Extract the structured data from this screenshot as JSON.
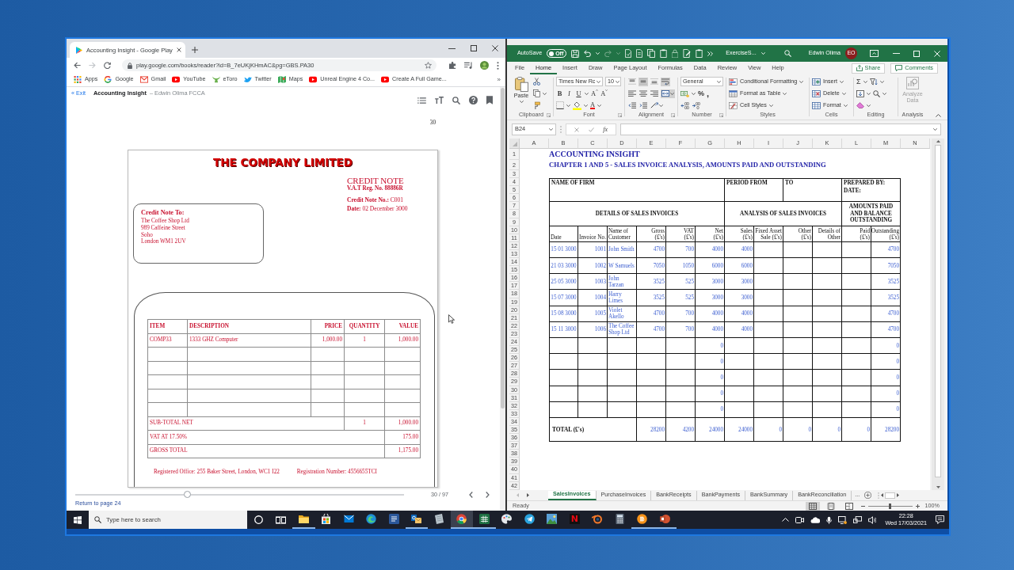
{
  "browser": {
    "tabs": [
      {
        "title": "Accounting Insight - Google Play",
        "selected": true
      }
    ],
    "forward": {
      "disabled": true
    },
    "address": "play.google.com/books/reader?id=B_7eUKjKHmAC&pg=GBS.PA30",
    "bookmarks": [
      {
        "label": "Apps",
        "kind": "apps"
      },
      {
        "label": "Google",
        "kind": "ring"
      },
      {
        "label": "Gmail",
        "kind": "envelope"
      },
      {
        "label": "YouTube",
        "kind": "play"
      },
      {
        "label": "eToro",
        "kind": "bull"
      },
      {
        "label": "Twitter",
        "kind": "bird"
      },
      {
        "label": "Maps",
        "kind": "map"
      },
      {
        "label": "Unreal Engine 4 Co...",
        "kind": "play"
      },
      {
        "label": "Create A Full Game...",
        "kind": "play"
      }
    ],
    "more_bookmarks": "»",
    "reader": {
      "exit": "« Exit",
      "book_title": "Accounting Insight",
      "author": "– Edwin Olima FCCA",
      "page_number": "30"
    },
    "document": {
      "company": "THE COMPANY LIMITED",
      "title": "CREDIT NOTE",
      "vat_reg": "V.A.T Reg. No. 88886R",
      "details": [
        "**Credit Note No.:** C001",
        "**Date:** 02 December 3000"
      ],
      "recipient": {
        "heading": "Credit Note To:",
        "lines": [
          "The Coffee Shop Ltd",
          "989 Caffeine Street",
          "Soho",
          "London WM1 2UV"
        ]
      },
      "columns": [
        "ITEM",
        "DESCRIPTION",
        "PRICE",
        "QUANTITY",
        "VALUE"
      ],
      "lines": [
        {
          "item": "COMP33",
          "description": "1333 GHZ Computer",
          "price": "1,000.00",
          "quantity": "1",
          "value": "1,000.00"
        }
      ],
      "totals": [
        {
          "label": "SUB-TOTAL NET",
          "quantity": "1",
          "value": "1,000.00"
        },
        {
          "label": "VAT AT 17.50%",
          "value": "175.00"
        },
        {
          "label": "GROSS TOTAL",
          "value": "1,175.00"
        }
      ],
      "footer": [
        "Registered Office: 255 Baker Street, London, WC1 I22",
        "Registration Number: 4556655TCI"
      ]
    },
    "footer": {
      "level": 0.34,
      "page_indicator": "30 / 97",
      "return_link": "Return to page 24"
    }
  },
  "excel": {
    "autosave": {
      "label": "AutoSave",
      "on": false,
      "text": "Off"
    },
    "redo": {
      "disabled": true
    },
    "file_name": "ExerciseS...",
    "user": {
      "name": "Edwin Olima",
      "initials": "EO"
    },
    "ribbon_tabs": [
      {
        "label": "File",
        "selected": false
      },
      {
        "label": "Home",
        "selected": true
      },
      {
        "label": "Insert",
        "selected": false
      },
      {
        "label": "Draw",
        "selected": false
      },
      {
        "label": "Page Layout",
        "selected": false
      },
      {
        "label": "Formulas",
        "selected": false
      },
      {
        "label": "Data",
        "selected": false
      },
      {
        "label": "Review",
        "selected": false
      },
      {
        "label": "View",
        "selected": false
      },
      {
        "label": "Help",
        "selected": false
      }
    ],
    "share": "Share",
    "comments": "Comments",
    "clipboard": {
      "paste": "Paste",
      "label": "Clipboard"
    },
    "font": {
      "face": "Times New Rc",
      "size": "10",
      "styles": [
        {
          "label": "B",
          "kind": "bold"
        },
        {
          "label": "I",
          "kind": "italic"
        },
        {
          "label": "U",
          "kind": "underline"
        }
      ],
      "grow": "A",
      "shrink": "A",
      "color_button": "A",
      "label": "Font"
    },
    "alignment": {
      "label": "Alignment",
      "buttons": [
        {
          "kind": "top",
          "selected": false
        },
        {
          "kind": "middle",
          "selected": true
        },
        {
          "kind": "bottom",
          "selected": false
        },
        {
          "kind": "wrap",
          "selected": true
        },
        {
          "kind": "left",
          "selected": false
        },
        {
          "kind": "center",
          "selected": false
        },
        {
          "kind": "right",
          "selected": false
        },
        {
          "kind": "merge",
          "selected": true
        },
        {
          "kind": "outdent",
          "selected": false
        },
        {
          "kind": "indent",
          "selected": false
        },
        {
          "kind": "orientation",
          "selected": false
        }
      ]
    },
    "number": {
      "format": "General",
      "percent": "%",
      "comma": ",",
      "label": "Number"
    },
    "styles": {
      "items": [
        {
          "label": "Conditional Formatting",
          "kind": "conditional"
        },
        {
          "label": "Format as Table",
          "kind": "table"
        },
        {
          "label": "Cell Styles",
          "kind": "cellstyle"
        }
      ],
      "label": "Styles"
    },
    "cells": {
      "items": [
        {
          "label": "Insert",
          "kind": "insert"
        },
        {
          "label": "Delete",
          "kind": "delete"
        },
        {
          "label": "Format",
          "kind": "format"
        }
      ],
      "label": "Cells"
    },
    "editing": {
      "sum": "Σ",
      "label": "Editing"
    },
    "analysis": {
      "button": "Analyze Data",
      "disabled": true,
      "label": "Analysis"
    },
    "formula_bar": {
      "name_box": "B24",
      "function_label": "fx"
    },
    "sheet": {
      "columns": [
        "A",
        "B",
        "C",
        "D",
        "E",
        "F",
        "G",
        "H",
        "I",
        "J",
        "K",
        "L",
        "M",
        "N"
      ],
      "rows": [
        "1",
        "2",
        "3",
        "4",
        "5",
        "6",
        "7",
        "8",
        "9",
        "10",
        "11",
        "12",
        "13",
        "14",
        "15",
        "16",
        "17",
        "18",
        "19",
        "20",
        "21",
        "22",
        "23",
        "24",
        "25",
        "26",
        "27",
        "28",
        "29",
        "30",
        "31",
        "32",
        "33",
        "34",
        "35",
        "36",
        "37",
        "38",
        "39",
        "40",
        "41",
        "42"
      ],
      "title": "ACCOUNTING INSIGHT",
      "subtitle": "CHAPTER 1 AND 5 - SALES INVOICE ANALYSIS, AMOUNTS PAID AND OUTSTANDING",
      "firm_label": "NAME OF FIRM",
      "period_from": "PERIOD FROM",
      "period_to": "TO",
      "prepared_by": "PREPARED BY:",
      "date_label": "DATE:",
      "sections": [
        "DETAILS OF SALES INVOICES",
        "ANALYSIS OF SALES INVOICES",
        "AMOUNTS PAID AND BALANCE OUTSTANDING"
      ],
      "headings": [
        [
          "Date"
        ],
        [
          "Invoice No."
        ],
        [
          "Name of",
          "Customer"
        ],
        [
          "Gross",
          "(£'s)"
        ],
        [
          "VAT",
          "(£'s)"
        ],
        [
          "Net",
          "(£'s)"
        ],
        [
          "Sales",
          "(£'s)"
        ],
        [
          "Fixed Asset",
          "Sale (£'s)"
        ],
        [
          "Other",
          "(£'s)"
        ],
        [
          "Details of",
          "Other"
        ],
        [
          "Paid",
          "(£'s)"
        ],
        [
          "Outstanding",
          "(£'s)"
        ]
      ],
      "entries": [
        {
          "date": "15 01 3000",
          "invoice": "1001",
          "customer": "John Smith",
          "gross": "4700",
          "vat": "700",
          "net": "4000",
          "sales": "4000",
          "outstanding": "4700"
        },
        {
          "date": "21 03 3000",
          "invoice": "1002",
          "customer": "W Samuels",
          "gross": "7050",
          "vat": "1050",
          "net": "6000",
          "sales": "6000",
          "outstanding": "7050"
        },
        {
          "date": "25 05 3000",
          "invoice": "1003",
          "customer": "John Tarzan",
          "gross": "3525",
          "vat": "525",
          "net": "3000",
          "sales": "3000",
          "outstanding": "3525"
        },
        {
          "date": "15 07 3000",
          "invoice": "1004",
          "customer": "Harry Limes",
          "gross": "3525",
          "vat": "525",
          "net": "3000",
          "sales": "3000",
          "outstanding": "3525"
        },
        {
          "date": "15 08 3000",
          "invoice": "1005",
          "customer": "Violet Akello",
          "gross": "4700",
          "vat": "700",
          "net": "4000",
          "sales": "4000",
          "outstanding": "4700"
        },
        {
          "date": "15 11 3000",
          "invoice": "1006",
          "customer": "The Coffee Shop Ltd",
          "gross": "4700",
          "vat": "700",
          "net": "4000",
          "sales": "4000",
          "outstanding": "4700"
        },
        {
          "net": "0",
          "outstanding": "0"
        },
        {
          "net": "0",
          "outstanding": "0"
        },
        {
          "net": "0",
          "outstanding": "0"
        },
        {
          "net": "0",
          "outstanding": "0"
        },
        {
          "net": "0",
          "outstanding": "0"
        }
      ],
      "total": {
        "label": "TOTAL (£'s)",
        "gross": "28200",
        "vat": "4200",
        "net": "24000",
        "sales": "24000",
        "fixed_asset": "0",
        "other": "0",
        "details": "0",
        "paid": "0",
        "outstanding": "28200"
      }
    },
    "sheet_tabs": [
      {
        "label": "SalesInvoices",
        "selected": true
      },
      {
        "label": "PurchaseInvoices",
        "selected": false
      },
      {
        "label": "BankReceipts",
        "selected": false
      },
      {
        "label": "BankPayments",
        "selected": false
      },
      {
        "label": "BankSummary",
        "selected": false
      },
      {
        "label": "BankReconciliation",
        "selected": false
      }
    ],
    "more_tabs": "...",
    "status": "Ready",
    "views": [
      {
        "kind": "normal",
        "selected": true
      },
      {
        "kind": "layout",
        "selected": false
      },
      {
        "kind": "pagebreak",
        "selected": false
      }
    ],
    "zoom": {
      "level": 0.5,
      "label": "100%"
    }
  },
  "taskbar": {
    "search": {
      "placeholder": "Type here to search"
    },
    "apps": [
      {
        "kind": "folder",
        "running": true,
        "active": false
      },
      {
        "kind": "bag",
        "running": false,
        "active": false
      },
      {
        "kind": "envelope",
        "running": false,
        "active": false
      },
      {
        "kind": "swirl",
        "running": false,
        "active": false
      },
      {
        "kind": "document",
        "running": false,
        "active": false
      },
      {
        "kind": "mailer",
        "running": true,
        "active": false
      },
      {
        "kind": "paper",
        "running": false,
        "active": false
      },
      {
        "kind": "browser",
        "running": true,
        "active": true
      },
      {
        "kind": "spreadsheet",
        "running": true,
        "active": false
      },
      {
        "kind": "palette",
        "running": false,
        "active": false
      },
      {
        "kind": "plane",
        "running": false,
        "active": false
      },
      {
        "kind": "picture",
        "running": false,
        "active": false
      },
      {
        "kind": "letter",
        "label": "N",
        "running": false,
        "active": false
      },
      {
        "kind": "orbit",
        "running": false,
        "active": false
      },
      {
        "kind": "calculator",
        "running": false,
        "active": false
      },
      {
        "kind": "coin",
        "running": true,
        "active": false
      },
      {
        "kind": "slides",
        "running": true,
        "active": false
      }
    ],
    "time": "22:28",
    "date": "Wed 17/03/2021"
  }
}
